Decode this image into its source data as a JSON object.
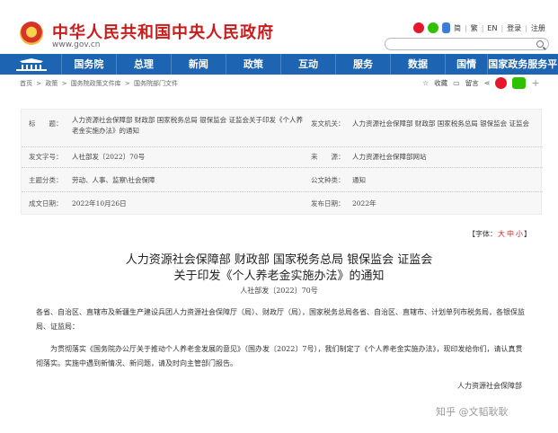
{
  "header": {
    "title": "中华人民共和国中央人民政府",
    "url": "www.gov.cn",
    "links": [
      "简",
      "繁",
      "EN",
      "登录",
      "注册"
    ],
    "search_placeholder": ""
  },
  "nav": {
    "items": [
      "国务院",
      "总理",
      "新闻",
      "政策",
      "互动",
      "服务",
      "数据",
      "国情",
      "国家政务服务平台"
    ]
  },
  "breadcrumb": [
    "首页",
    ">",
    "政策",
    ">",
    "国务院政策文件库",
    ">",
    "国务院部门文件"
  ],
  "tools": {
    "favorite": "收藏",
    "comment": "留言"
  },
  "info": {
    "title_label": "标　　题：",
    "title_value": "人力资源社会保障部 财政部 国家税务总局 银保监会 证监会关于印发《个人养老金实施办法》的通知",
    "issuer_label": "发文机关：",
    "issuer_value": "人力资源社会保障部 财政部 国家税务总局 银保监会 证监会",
    "docno_label": "发文字号：",
    "docno_value": "人社部发〔2022〕70号",
    "source_label": "来　　源：",
    "source_value": "人力资源社会保障部网站",
    "topic_label": "主题分类：",
    "topic_value": "劳动、人事、监察\\社会保障",
    "type_label": "公文种类：",
    "type_value": "通知",
    "date_label": "成文日期：",
    "date_value": "2022年10月26日",
    "pub_label": "发布日期：",
    "pub_value": "2022年"
  },
  "article": {
    "font_size_prefix": "【字体：",
    "font_big": "大",
    "font_mid": "中",
    "font_small": "小",
    "font_size_suffix": "】",
    "title_line1": "人力资源社会保障部 财政部 国家税务总局 银保监会 证监会",
    "title_line2": "关于印发《个人养老金实施办法》的通知",
    "doc_no": "人社部发〔2022〕70号",
    "para1": "各省、自治区、直辖市及新疆生产建设兵团人力资源社会保障厅（局）、财政厅（局），国家税务总局各省、自治区、直辖市、计划单列市税务局，各银保监局、证监局：",
    "para2": "为贯彻落实《国务院办公厅关于推动个人养老金发展的意见》（国办发〔2022〕7号），我们制定了《个人养老金实施办法》，现印发给你们，请认真贯彻落实。实施中遇到新情况、新问题，请及时向主管部门报告。",
    "signature": "人力资源社会保障部"
  },
  "watermark": "知乎 @文韬耿耿"
}
